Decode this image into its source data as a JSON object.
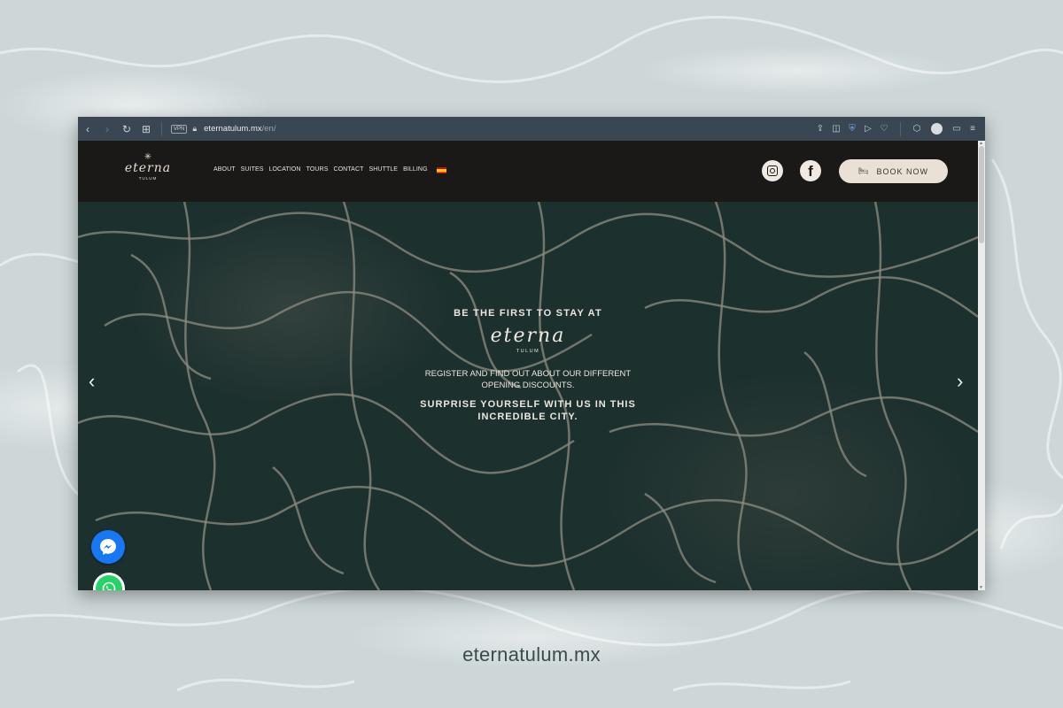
{
  "browser": {
    "vpn_label": "VPN",
    "url_host": "eternatulum.mx",
    "url_path": "/en/"
  },
  "site": {
    "logo_name": "eterna",
    "logo_sub": "TULUM",
    "nav": [
      {
        "label": "ABOUT"
      },
      {
        "label": "SUITES"
      },
      {
        "label": "LOCATION"
      },
      {
        "label": "TOURS"
      },
      {
        "label": "CONTACT"
      },
      {
        "label": "SHUTTLE"
      },
      {
        "label": "BILLING"
      }
    ],
    "book_label": "BOOK NOW"
  },
  "hero": {
    "kicker": "BE THE FIRST TO STAY AT",
    "logo_name": "eterna",
    "logo_sub": "TULUM",
    "body": "REGISTER AND FIND OUT ABOUT OUR DIFFERENT OPENING DISCOUNTS.",
    "strong": "SURPRISE YOURSELF WITH US IN THIS INCREDIBLE CITY."
  },
  "caption": "eternatulum.mx",
  "colors": {
    "header_bg": "#1a1918",
    "hero_water": "#1c302e",
    "book_button": "#e9e0d6",
    "messenger": "#1877f2",
    "whatsapp": "#25d366",
    "toolbar": "#3b4653"
  },
  "icons": [
    "back-icon",
    "forward-icon",
    "reload-icon",
    "grid-icon",
    "lock-icon",
    "instagram-icon",
    "facebook-icon",
    "bed-icon",
    "messenger-icon",
    "whatsapp-icon",
    "chevron-left-icon",
    "chevron-right-icon"
  ]
}
